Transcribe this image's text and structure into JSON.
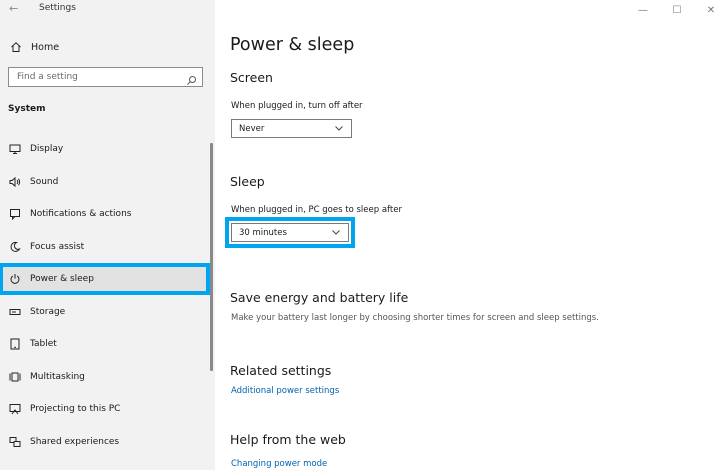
{
  "window": {
    "app_title": "Settings",
    "back": "←",
    "minimize": "—",
    "maximize": "☐",
    "close": "✕"
  },
  "sidebar": {
    "home_label": "Home",
    "search_placeholder": "Find a setting",
    "section_label": "System",
    "items": [
      {
        "label": "Display",
        "icon": "display-icon"
      },
      {
        "label": "Sound",
        "icon": "sound-icon"
      },
      {
        "label": "Notifications & actions",
        "icon": "notifications-icon"
      },
      {
        "label": "Focus assist",
        "icon": "focus-assist-icon"
      },
      {
        "label": "Power & sleep",
        "icon": "power-icon",
        "selected": true
      },
      {
        "label": "Storage",
        "icon": "storage-icon"
      },
      {
        "label": "Tablet",
        "icon": "tablet-icon"
      },
      {
        "label": "Multitasking",
        "icon": "multitasking-icon"
      },
      {
        "label": "Projecting to this PC",
        "icon": "projecting-icon"
      },
      {
        "label": "Shared experiences",
        "icon": "shared-icon"
      }
    ]
  },
  "main": {
    "page_title": "Power & sleep",
    "screen": {
      "heading": "Screen",
      "label": "When plugged in, turn off after",
      "value": "Never"
    },
    "sleep": {
      "heading": "Sleep",
      "label": "When plugged in, PC goes to sleep after",
      "value": "30 minutes"
    },
    "save_energy": {
      "heading": "Save energy and battery life",
      "desc": "Make your battery last longer by choosing shorter times for screen and sleep settings."
    },
    "related": {
      "heading": "Related settings",
      "link": "Additional power settings"
    },
    "help": {
      "heading": "Help from the web",
      "link": "Changing power mode"
    }
  },
  "colors": {
    "accent": "#00a4ef",
    "link": "#0063b1",
    "sidebar_bg": "#f2f2f2"
  }
}
